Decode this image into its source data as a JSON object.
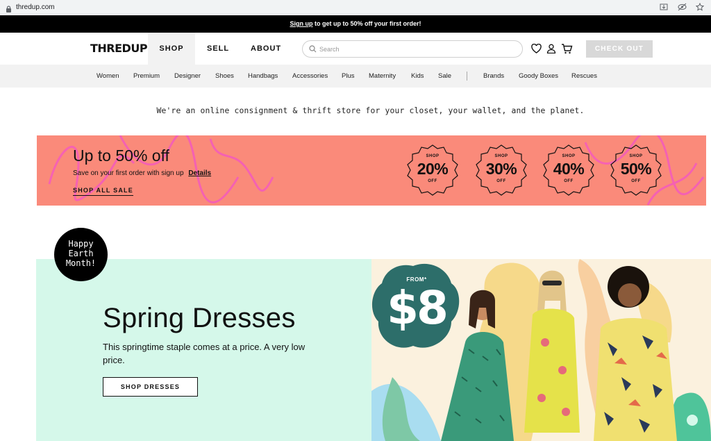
{
  "browser": {
    "url": "thredup.com"
  },
  "promo_strip": {
    "link": "Sign up",
    "text": " to get up to 50% off your first order!"
  },
  "header": {
    "logo": "THREDUP",
    "nav": {
      "shop": "SHOP",
      "sell": "SELL",
      "about": "ABOUT"
    },
    "search_placeholder": "Search",
    "checkout": "CHECK OUT"
  },
  "categories": [
    "Women",
    "Premium",
    "Designer",
    "Shoes",
    "Handbags",
    "Accessories",
    "Plus",
    "Maternity",
    "Kids",
    "Sale",
    "Brands",
    "Goody Boxes",
    "Rescues"
  ],
  "tagline": "We're an online consignment & thrift store for your closet, your wallet, and the planet.",
  "sale_banner": {
    "title": "Up to 50% off",
    "subtitle": "Save on your first order with sign up",
    "details": "Details",
    "shop_all": "SHOP ALL SALE",
    "badges": [
      {
        "top": "SHOP",
        "pct": "20%",
        "bottom": "OFF"
      },
      {
        "top": "SHOP",
        "pct": "30%",
        "bottom": "OFF"
      },
      {
        "top": "SHOP",
        "pct": "40%",
        "bottom": "OFF"
      },
      {
        "top": "SHOP",
        "pct": "50%",
        "bottom": "OFF"
      }
    ]
  },
  "spring": {
    "earth_badge": [
      "Happy",
      "Earth",
      "Month!"
    ],
    "title": "Spring Dresses",
    "desc": "This springtime staple comes at a price. ⁣A very low price.",
    "button": "SHOP DRESSES",
    "price_from": "FROM*",
    "price": "$8"
  },
  "colors": {
    "promo_bg": "#000000",
    "sale_bg": "#fa8a7a",
    "squiggle": "#f45bbd",
    "spring_bg": "#d5f8ea",
    "price_blob": "#2d6e6a",
    "checkout_bg": "#d8d8d8"
  }
}
